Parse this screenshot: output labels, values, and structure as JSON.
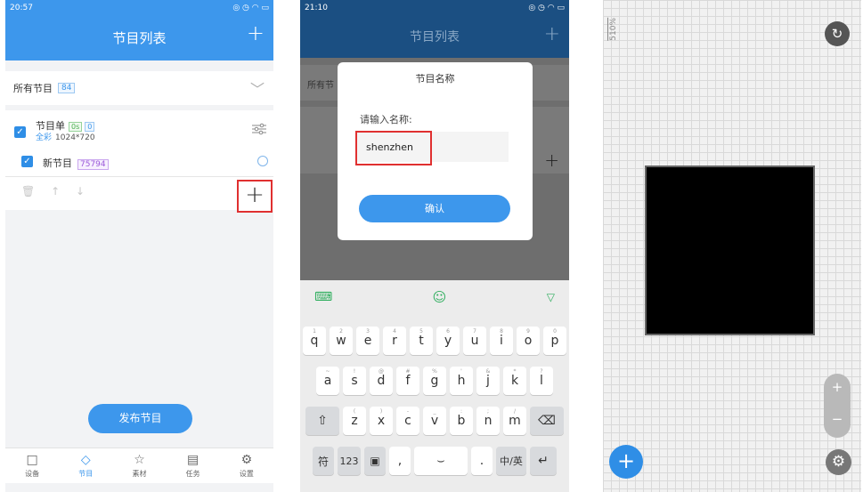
{
  "panel1": {
    "status": {
      "time": "20:57",
      "icons": "◎ ◷ ◠ ▭"
    },
    "title": "节目列表",
    "add_icon": "+",
    "all_programs": {
      "label": "所有节目",
      "count": "84"
    },
    "program": {
      "name": "节目单",
      "tag_duration": "0s",
      "tag_count": "0",
      "color_mode": "全彩",
      "resolution": "1024*720",
      "sub_item": {
        "name": "新节目",
        "id": "75794"
      }
    },
    "publish": "发布节目",
    "nav": [
      {
        "label": "设备",
        "icon": "□"
      },
      {
        "label": "节目",
        "icon": "◇"
      },
      {
        "label": "素材",
        "icon": "☆"
      },
      {
        "label": "任务",
        "icon": "▤"
      },
      {
        "label": "设置",
        "icon": "⚙"
      }
    ],
    "accent": "#3d97ec"
  },
  "panel2": {
    "status": {
      "time": "21:10",
      "icons": "◎ ◷ ◠ ▭"
    },
    "title": "节目列表",
    "ghost_label": "所有节",
    "dialog": {
      "title": "节目名称",
      "label": "请输入名称:",
      "input_value": "shenzhen",
      "confirm": "确认"
    },
    "keyboard": {
      "row1": [
        {
          "k": "q",
          "h": "1"
        },
        {
          "k": "w",
          "h": "2"
        },
        {
          "k": "e",
          "h": "3"
        },
        {
          "k": "r",
          "h": "4"
        },
        {
          "k": "t",
          "h": "5"
        },
        {
          "k": "y",
          "h": "6"
        },
        {
          "k": "u",
          "h": "7"
        },
        {
          "k": "i",
          "h": "8"
        },
        {
          "k": "o",
          "h": "9"
        },
        {
          "k": "p",
          "h": "0"
        }
      ],
      "row2": [
        {
          "k": "a",
          "h": "~"
        },
        {
          "k": "s",
          "h": "!"
        },
        {
          "k": "d",
          "h": "@"
        },
        {
          "k": "f",
          "h": "#"
        },
        {
          "k": "g",
          "h": "%"
        },
        {
          "k": "h",
          "h": "'"
        },
        {
          "k": "j",
          "h": "&"
        },
        {
          "k": "k",
          "h": "*"
        },
        {
          "k": "l",
          "h": "?"
        }
      ],
      "row3": [
        {
          "k": "z",
          "h": "("
        },
        {
          "k": "x",
          "h": ")"
        },
        {
          "k": "c",
          "h": "-"
        },
        {
          "k": "v",
          "h": "_"
        },
        {
          "k": "b",
          "h": ":"
        },
        {
          "k": "n",
          "h": ";"
        },
        {
          "k": "m",
          "h": "/"
        }
      ],
      "shift": "⇧",
      "delete": "⌫",
      "symbols": "符",
      "numbers": "123",
      "lang_toggle_icon": "▣",
      "comma": ",",
      "space_icon": "⌣",
      "period": ".",
      "cn_en": "中/英",
      "enter": "↵"
    }
  },
  "panel3": {
    "zoom": "510%",
    "rotate_icon": "↻",
    "zoom_in": "+",
    "zoom_out": "−",
    "add_icon": "+",
    "settings_icon": "⚙"
  }
}
